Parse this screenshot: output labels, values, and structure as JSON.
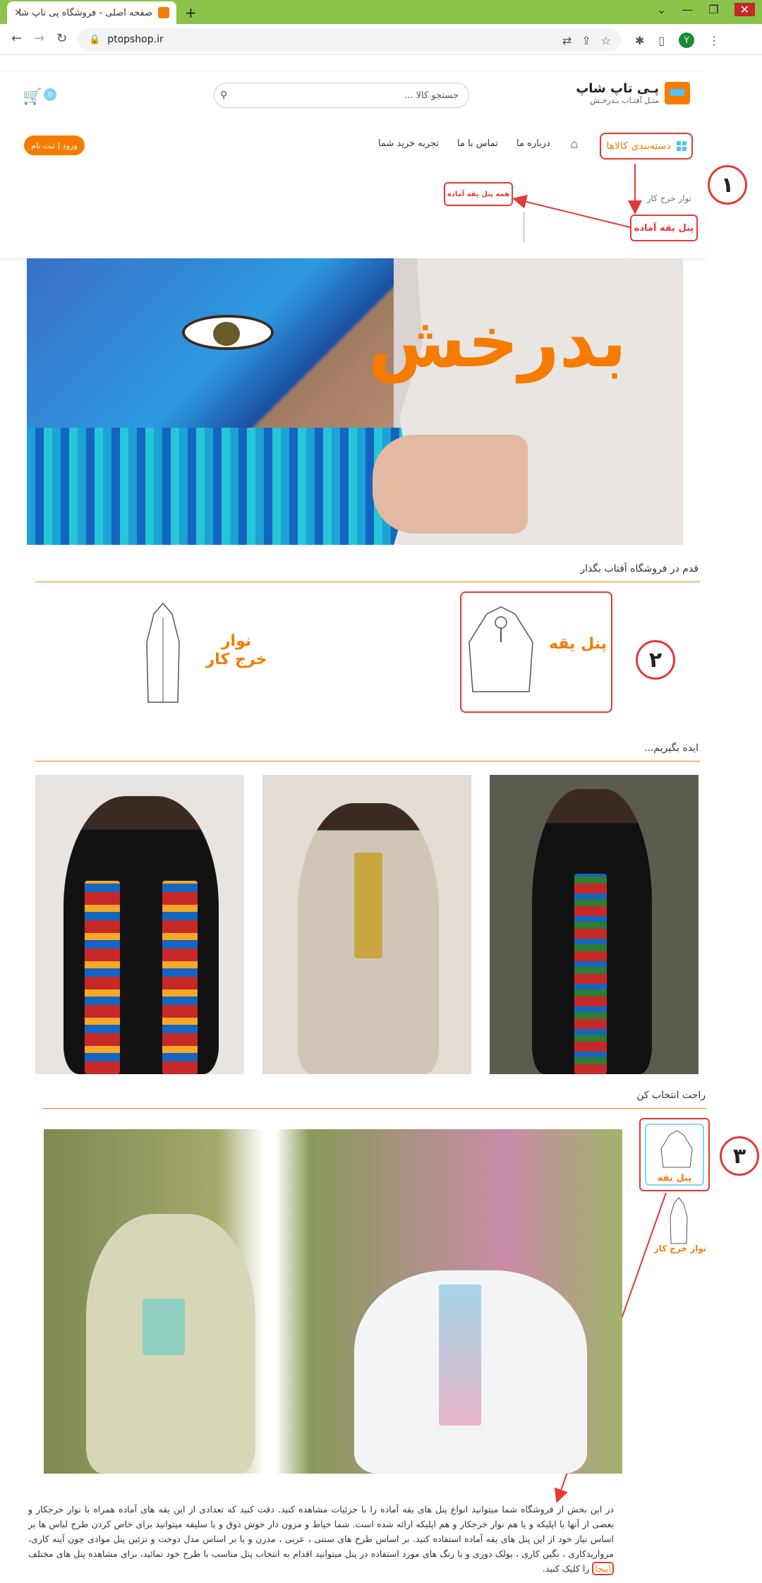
{
  "browser": {
    "tab_title": "صفحه اصلی - فروشگاه پی تاپ شا",
    "close_glyph": "×",
    "new_tab_glyph": "+",
    "url": "ptopshop.ir",
    "profile_initial": "Y",
    "window_controls": [
      "⌄",
      "—",
      "❐",
      "✕"
    ]
  },
  "header": {
    "logo_name": "پـی تاپ شاپ",
    "logo_tagline": "مثـل آفتـاب بـدرخـش",
    "search_placeholder": "جستجو کالا ...",
    "cart_count": "0",
    "login_label": "ورود | ثبت نام"
  },
  "nav": {
    "categories_label": "دسته‌بندی کالاها",
    "items": [
      "درباره ما",
      "تماس با ما",
      "تجربه خرید شما"
    ]
  },
  "dropdown": {
    "item_plain": "نوار خرج کار",
    "item_highlight": "پنل یقه آماده",
    "submenu_all": "همه پنل یقه آماده"
  },
  "callouts": [
    "١",
    "٢",
    "٣"
  ],
  "hero": {
    "headline": "بدرخش"
  },
  "section_step": {
    "title": "قدم در فروشگاه آفتاب بگذار",
    "cards": [
      {
        "label_line1": "پنل",
        "label_line2": "یقه"
      },
      {
        "label_line1": "نوار",
        "label_line2": "خرج کار"
      }
    ]
  },
  "section_ideas": {
    "title": "ایده بگیریم..."
  },
  "section_choose": {
    "title": "راحت انتخاب کن",
    "thumbs": [
      "پنل یقه",
      "نوار خرج کار"
    ]
  },
  "paragraph": {
    "text": "در این بخش از فروشگاه شما میتوانید انواع پنل های یقه آماده را با جزئیات مشاهده کنید. دقت کنید که تعدادی از این یقه های آماده همراه با نوار خرجکار و بعضی از آنها با اپلیکه و یا هم نوار خرجکار و هم اپلیکه ارائه شده است. شما خیاط و مزون دار خوش ذوق و با سلیقه میتوانید برای خاص کردن طرح لباس ها بر اساس نیاز خود از این پنل های یقه آماده استفاده کنید. بر اساس طرح های سنتی ، عربی ، مدرن و یا بر اساس مدل دوخت و تزئین پنل موادی چون آینه کاری، مرواریدکاری ، نگین کاری ، پولک دوزی و یا رنگ های مورد استفاده در پنل میتوانید اقدام به انتخاب پنل مناسب با طرح خود نمائید، برای مشاهده پنل های مختلف",
    "link_text": "اینجا",
    "tail": "را کلیک کنید."
  },
  "colors": {
    "accent": "#f57c00",
    "annotation": "#e53935",
    "secondary": "#4fc3f7"
  }
}
